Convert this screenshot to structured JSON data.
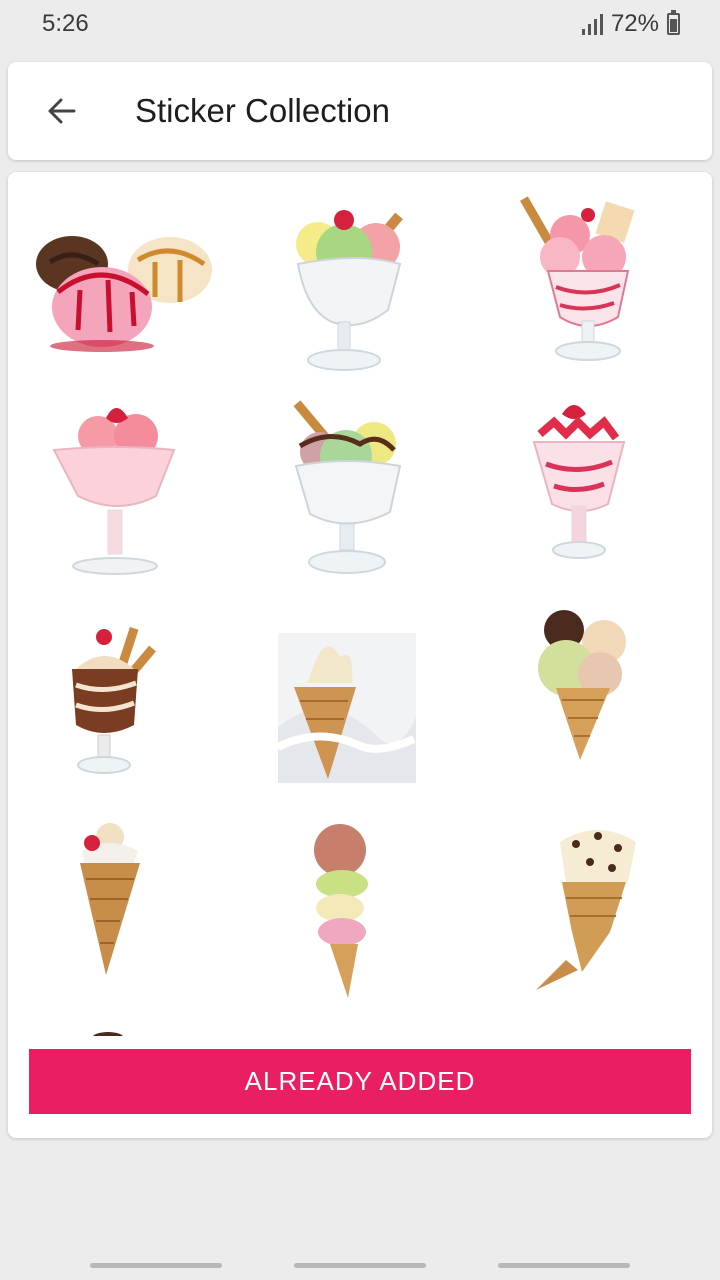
{
  "status_bar": {
    "time": "5:26",
    "battery_percent": "72%",
    "signal_icon": "signal-icon",
    "battery_icon": "battery-charging-icon"
  },
  "app_bar": {
    "back_icon": "arrow-back-icon",
    "title": "Sticker Collection"
  },
  "stickers": [
    {
      "name": "sticker-ice-cream-scoops-with-syrup"
    },
    {
      "name": "sticker-sundae-glass-green-pink-scoops"
    },
    {
      "name": "sticker-strawberry-sundae-wafer"
    },
    {
      "name": "sticker-pink-sundae-strawberry"
    },
    {
      "name": "sticker-sundae-glass-chocolate-wafer"
    },
    {
      "name": "sticker-strawberry-parfait"
    },
    {
      "name": "sticker-chocolate-sundae-cherry"
    },
    {
      "name": "sticker-soft-serve-cone-splash"
    },
    {
      "name": "sticker-triple-scoop-cone"
    },
    {
      "name": "sticker-cherry-cone"
    },
    {
      "name": "sticker-stacked-scoops-cone"
    },
    {
      "name": "sticker-chocolate-chip-cone"
    }
  ],
  "button": {
    "label": "ALREADY ADDED"
  },
  "colors": {
    "accent": "#e91e63",
    "background": "#ececed",
    "card": "#ffffff"
  }
}
